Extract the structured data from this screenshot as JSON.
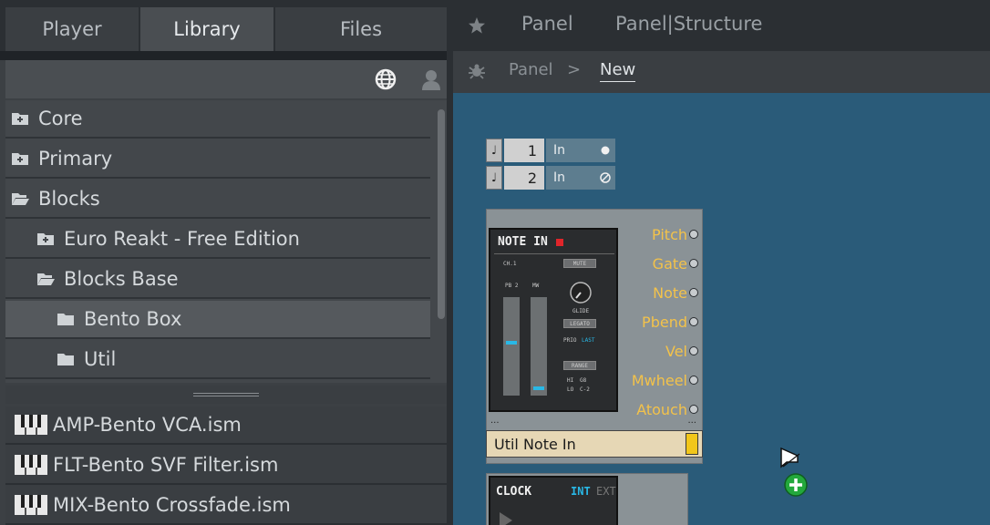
{
  "browser": {
    "tabs": [
      {
        "label": "Player"
      },
      {
        "label": "Library"
      },
      {
        "label": "Files"
      }
    ],
    "active_tab": "Library",
    "tree": [
      {
        "label": "Core",
        "icon": "folder-plus-icon",
        "level": 0
      },
      {
        "label": "Primary",
        "icon": "folder-plus-icon",
        "level": 0
      },
      {
        "label": "Blocks",
        "icon": "folder-open-icon",
        "level": 0
      },
      {
        "label": "Euro Reakt - Free Edition",
        "icon": "folder-plus-icon",
        "level": 1
      },
      {
        "label": "Blocks Base",
        "icon": "folder-open-icon",
        "level": 1
      },
      {
        "label": "Bento Box",
        "icon": "folder-icon",
        "level": 2,
        "selected": true
      },
      {
        "label": "Util",
        "icon": "folder-icon",
        "level": 2
      }
    ],
    "files": [
      {
        "label": "AMP-Bento VCA.ism"
      },
      {
        "label": "FLT-Bento SVF Filter.ism"
      },
      {
        "label": "MIX-Bento Crossfade.ism"
      }
    ]
  },
  "editor": {
    "header_panel": "Panel",
    "header_structure": "Panel|Structure",
    "breadcrumb_root": "Panel",
    "breadcrumb_separator": ">",
    "breadcrumb_current": "New",
    "midi_ports": [
      {
        "note_glyph": "♩",
        "number": "1",
        "label": "In"
      },
      {
        "note_glyph": "♩",
        "number": "2",
        "label": "In"
      }
    ],
    "macro": {
      "title": "NOTE IN",
      "name": "Util Note In",
      "outputs": [
        "Pitch",
        "Gate",
        "Note",
        "Pbend",
        "Vel",
        "Mwheel",
        "Atouch"
      ],
      "small_text": {
        "ch": "CH.1",
        "mute": "MUTE",
        "pb": "PB 2",
        "mw": "MW",
        "glide": "GLIDE",
        "legato": "LEGATO",
        "prio": "PRIO",
        "last": "LAST",
        "range": "RANGE",
        "hi": "HI",
        "hi_val": "G8",
        "lo": "LO",
        "lo_val": "C-2"
      },
      "dots": "..."
    },
    "clock": {
      "title": "CLOCK",
      "int_label": "INT",
      "ext_label": "EXT"
    }
  },
  "colors": {
    "canvas": "#2a5b79",
    "output_label": "#f3c24a",
    "accent_blue": "#29b8e6",
    "rec_red": "#e0252a"
  }
}
